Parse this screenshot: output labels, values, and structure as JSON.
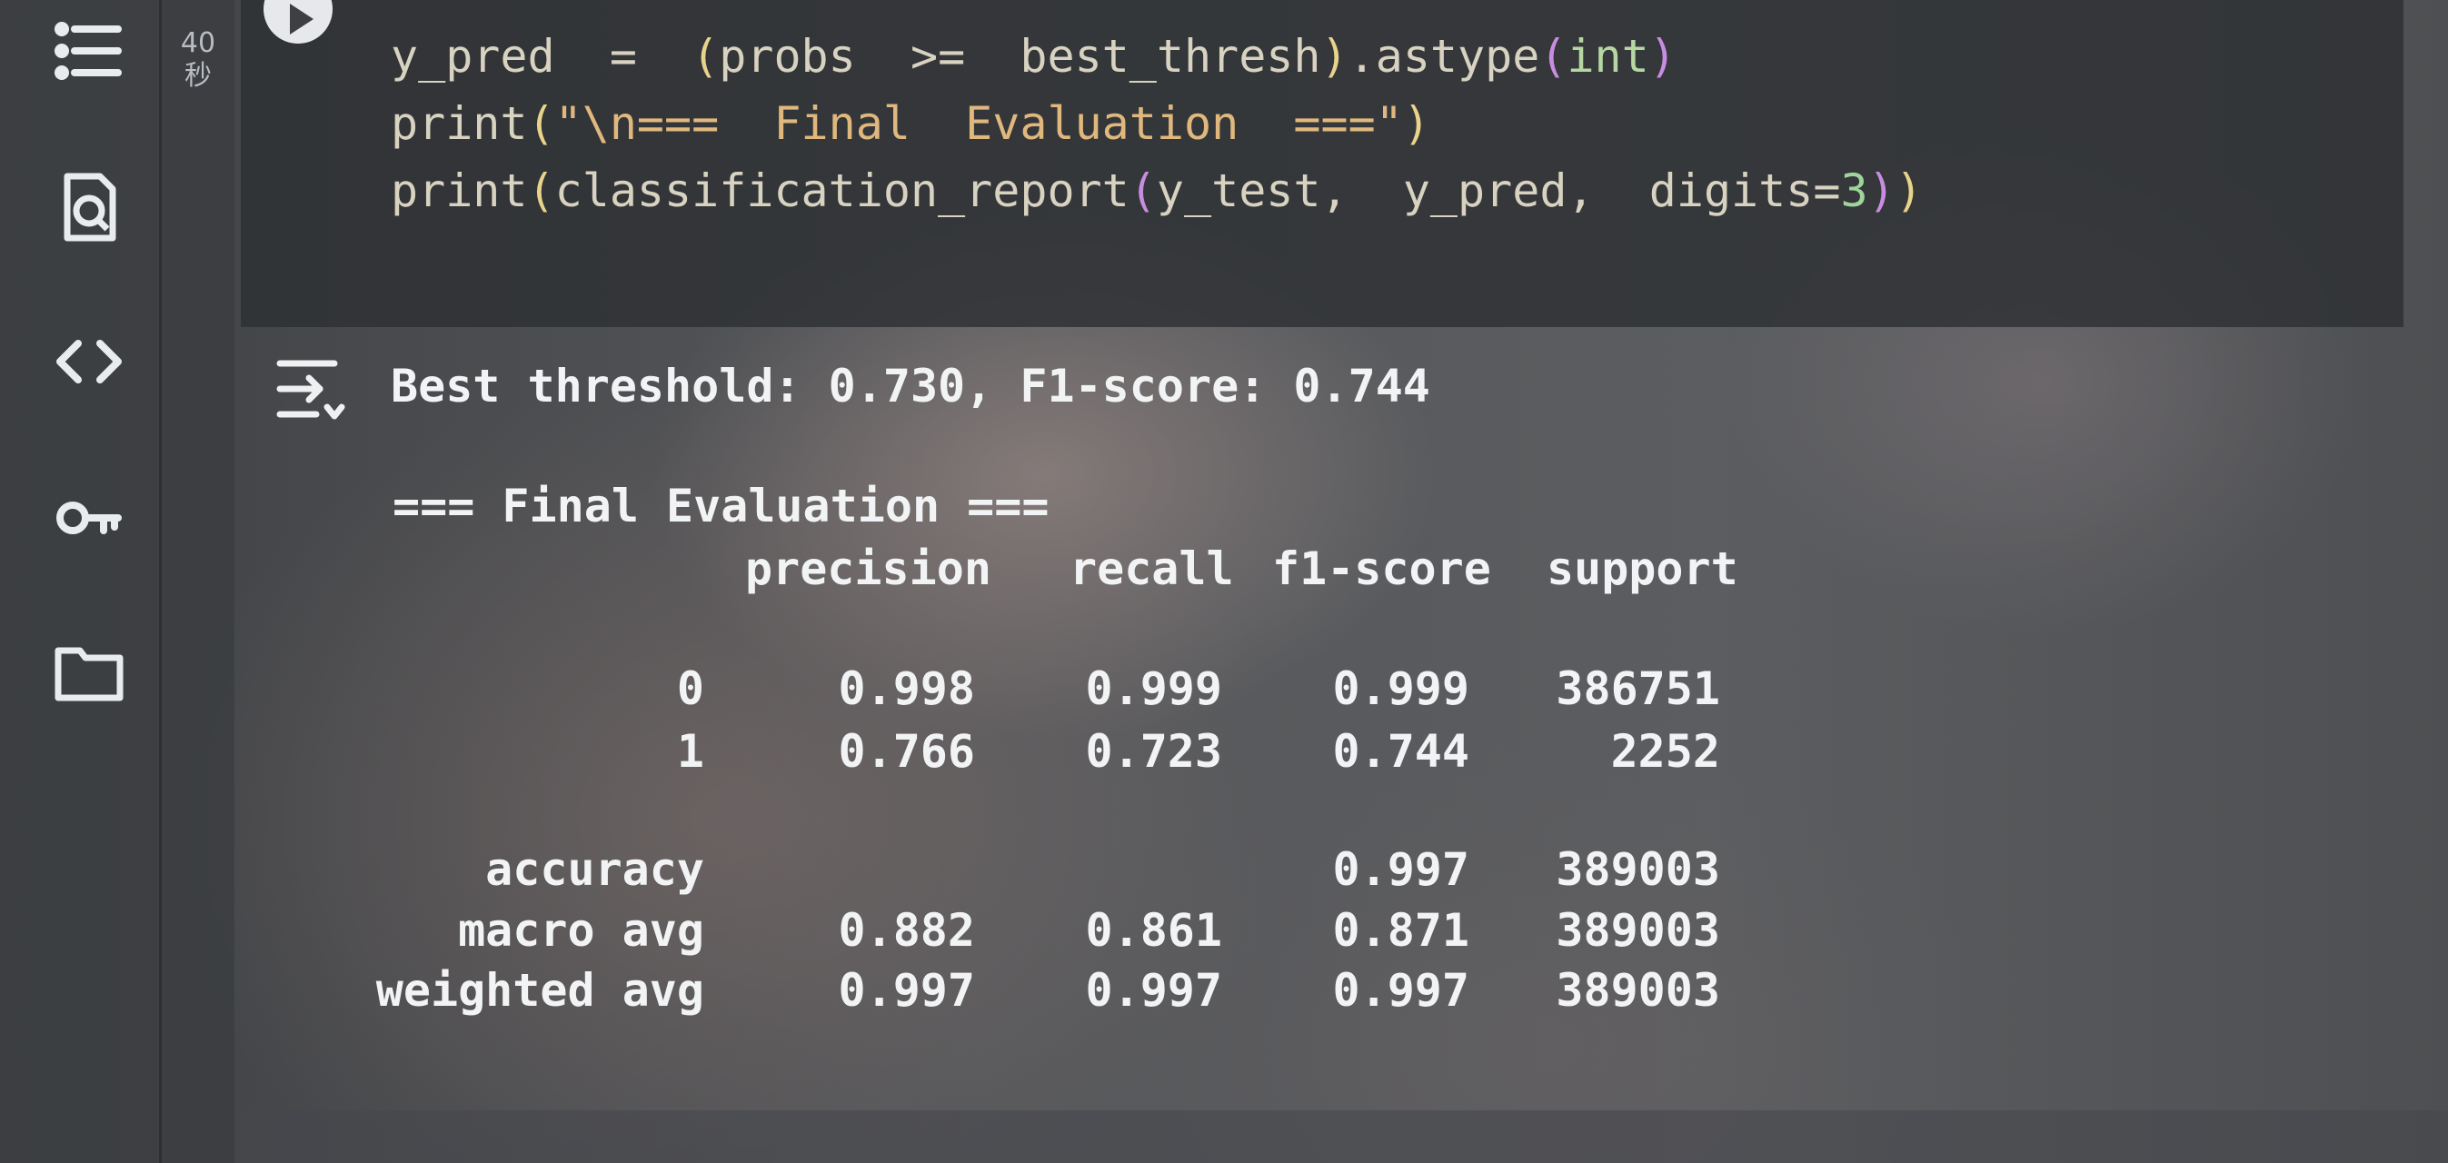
{
  "cell": {
    "execution_count": "40",
    "execution_unit": "秒",
    "code_lines": [
      "y_pred = (probs >= best_thresh).astype(int)",
      "print(\"\\n=== Final Evaluation ===\")",
      "print(classification_report(y_test, y_pred, digits=3))"
    ]
  },
  "output": {
    "best_line": "Best threshold: 0.730, F1-score: 0.744",
    "section_title": "=== Final Evaluation ===",
    "headers": [
      "precision",
      "recall",
      "f1-score",
      "support"
    ],
    "rows": [
      {
        "label": "0",
        "precision": "0.998",
        "recall": "0.999",
        "f1": "0.999",
        "support": "386751"
      },
      {
        "label": "1",
        "precision": "0.766",
        "recall": "0.723",
        "f1": "0.744",
        "support": "2252"
      },
      {
        "label": "accuracy",
        "precision": "",
        "recall": "",
        "f1": "0.997",
        "support": "389003"
      },
      {
        "label": "macro avg",
        "precision": "0.882",
        "recall": "0.861",
        "f1": "0.871",
        "support": "389003"
      },
      {
        "label": "weighted avg",
        "precision": "0.997",
        "recall": "0.997",
        "f1": "0.997",
        "support": "389003"
      }
    ]
  },
  "sidebar": {
    "icons": [
      "table-of-contents-icon",
      "find-icon",
      "code-snippets-icon",
      "secrets-key-icon",
      "files-folder-icon"
    ]
  }
}
